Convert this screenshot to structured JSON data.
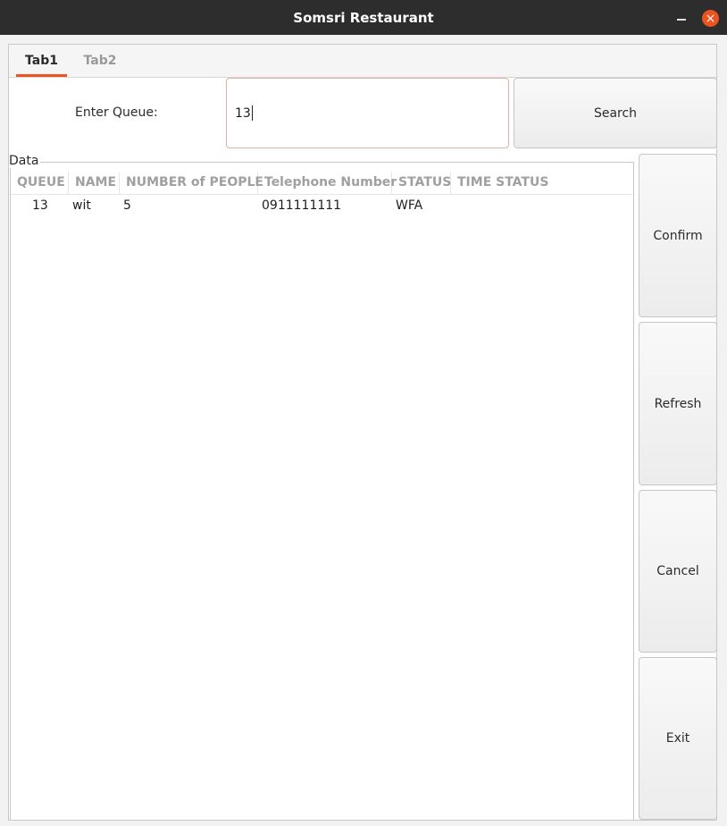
{
  "window": {
    "title": "Somsri Restaurant",
    "close_glyph": "×"
  },
  "tabs": [
    {
      "label": "Tab1",
      "active": true
    },
    {
      "label": "Tab2",
      "active": false
    }
  ],
  "queue": {
    "label": "Enter Queue:",
    "value": "13"
  },
  "buttons": {
    "search": "Search",
    "confirm": "Confirm",
    "refresh": "Refresh",
    "cancel": "Cancel",
    "exit": "Exit"
  },
  "data_group": {
    "label": "Data"
  },
  "table": {
    "columns": [
      "QUEUE",
      "NAME",
      "NUMBER of PEOPLE",
      "Telephone Number",
      "STATUS",
      "TIME STATUS"
    ],
    "rows": [
      [
        "13",
        "wit",
        "5",
        "0911111111",
        "WFA",
        ""
      ]
    ]
  },
  "colors": {
    "accent": "#e95420",
    "titlebar": "#2d2d2d"
  }
}
